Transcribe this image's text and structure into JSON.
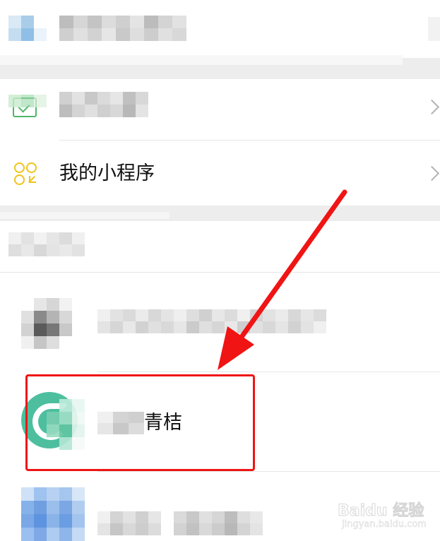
{
  "menu": {
    "mini_programs_label": "我的小程序",
    "mini_program_icon": "mini-program-grid-icon",
    "chevron_icon": "chevron-right-icon",
    "wallet_icon": "wallet-icon"
  },
  "list": {
    "highlighted_item_label": "青桔",
    "highlighted_item_icon": "qingju-app-icon",
    "brand_color": "#4dbf9f"
  },
  "annotation": {
    "arrow_color": "#f01414",
    "watermark_brand": "Baidu 经验",
    "watermark_url": "jingyan.baidu.com"
  }
}
